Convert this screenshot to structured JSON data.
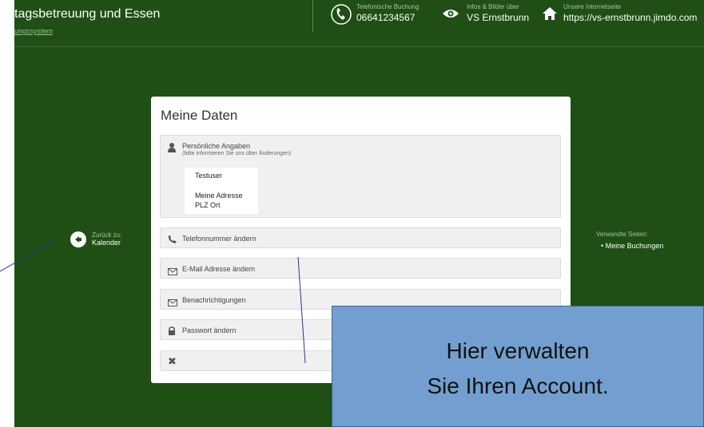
{
  "header": {
    "site_title": "tagsbetreuung und Essen",
    "site_subtitle": "ungssystem",
    "phone_caption": "Telefonische Buchung",
    "phone_number": "06641234567",
    "info_caption": "Infos & Bilder über",
    "info_value": "VS Ernstbrunn",
    "web_caption": "Unsere Internetseite",
    "web_value": "https://vs-ernstbrunn.jimdo.com"
  },
  "left_nav": {
    "caption": "Zurück zu:",
    "link": "Kalender"
  },
  "right_nav": {
    "caption": "Verwandte Seiten:",
    "link": "• Meine Buchungen"
  },
  "card": {
    "title": "Meine Daten",
    "personal": {
      "heading": "Persönliche Angaben",
      "note": "(bitte informieren Sie uns über Änderungen)",
      "name": "Testuser",
      "address_line1": "Meine Adresse",
      "address_line2": "PLZ Ort"
    },
    "sections": [
      {
        "label": "Telefonnummer ändern",
        "icon": "phone-icon"
      },
      {
        "label": "E-Mail Adresse ändern",
        "icon": "envelope-icon"
      },
      {
        "label": "Benachrichtigungen",
        "icon": "envelope-icon"
      },
      {
        "label": "Passwort ändern",
        "icon": "lock-icon"
      }
    ],
    "close_icon": "close-icon"
  },
  "callout": {
    "line1": "Hier verwalten",
    "line2": "Sie Ihren Account."
  },
  "colors": {
    "background": "#1f4f14",
    "callout": "#729fcf",
    "panel": "#f0f0f0"
  }
}
